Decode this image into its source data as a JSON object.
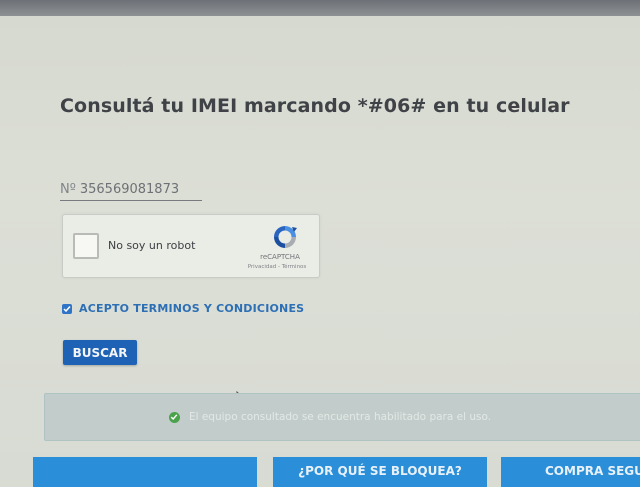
{
  "heading": "Consultá tu IMEI marcando *#06# en tu celular",
  "imei": {
    "prefix": "Nº",
    "value": "356569081873"
  },
  "recaptcha": {
    "label": "No soy un robot",
    "brand": "reCAPTCHA",
    "links": "Privacidad - Términos"
  },
  "terms": {
    "label": "ACEPTO TERMINOS Y CONDICIONES",
    "checked": true
  },
  "search_button": {
    "label": "BUSCAR"
  },
  "status": {
    "message": "El equipo consultado se encuentra habilitado para el uso."
  },
  "bottom_buttons": [
    {
      "label": ""
    },
    {
      "label": "¿POR QUÉ SE BLOQUEA?"
    },
    {
      "label": "COMPRA SEGU"
    }
  ],
  "colors": {
    "primary": "#1e62b6",
    "accent": "#2a8fd8",
    "success": "#4aa24d",
    "heading": "#3f4246"
  }
}
